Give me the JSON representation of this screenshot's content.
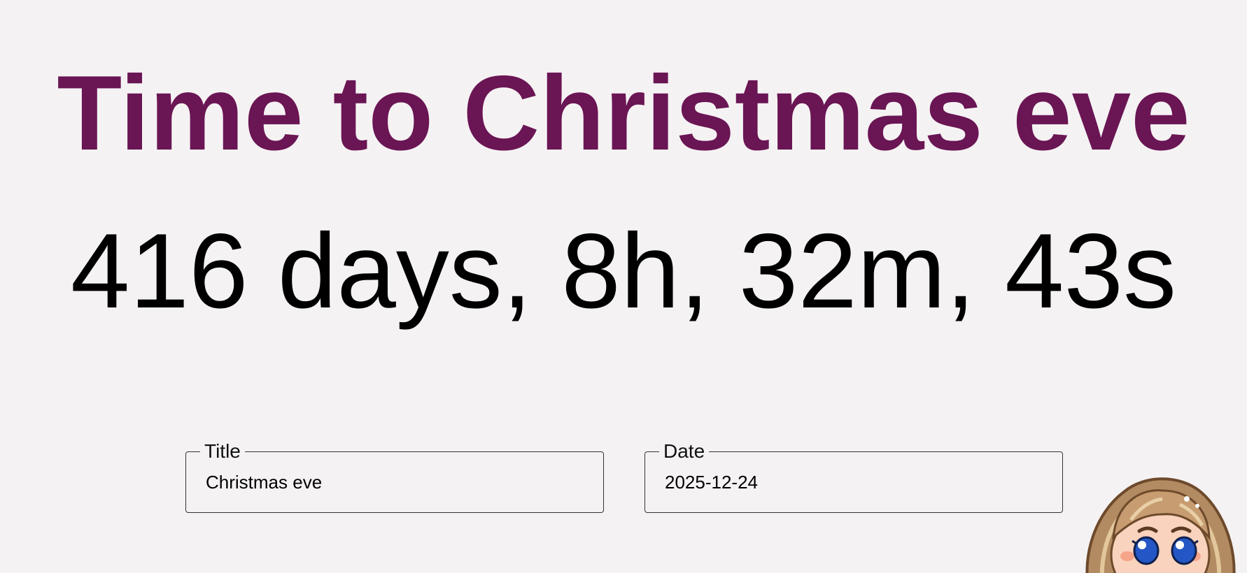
{
  "heading": "Time to Christmas eve",
  "countdown": "416 days, 8h, 32m, 43s",
  "form": {
    "title_label": "Title",
    "title_value": "Christmas eve",
    "date_label": "Date",
    "date_value": "2025-12-24"
  },
  "colors": {
    "heading": "#6a1554",
    "background": "#f5f2f3"
  },
  "icons": {
    "mascot": "cartoon-girl-avatar"
  }
}
